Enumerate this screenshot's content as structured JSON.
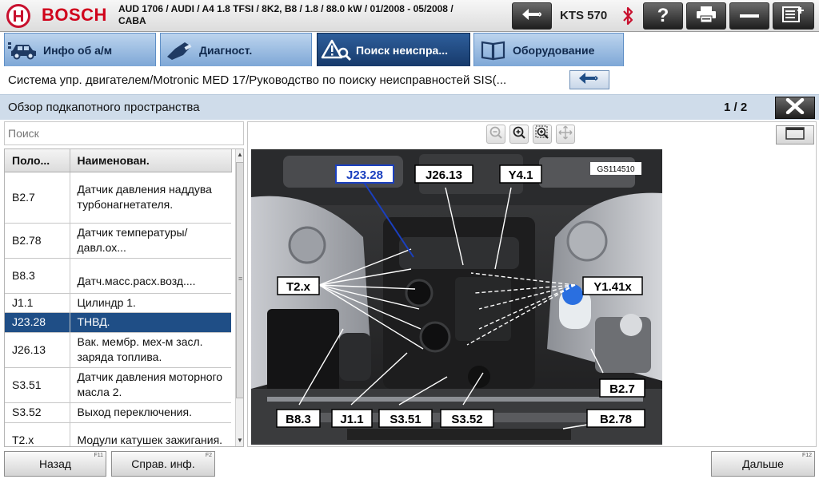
{
  "header": {
    "brand": "BOSCH",
    "vehicle_line1": "AUD 1706 / AUDI / A4 1.8 TFSI / 8K2, B8 / 1.8 / 88.0 kW / 01/2008 - 05/2008 /",
    "vehicle_line2": "CABA",
    "device": "KTS 570",
    "icons": [
      "back-arrow-icon",
      "bluetooth-icon",
      "help-icon",
      "print-icon",
      "minimize-icon",
      "menu-icon"
    ]
  },
  "tabs": [
    {
      "label": "Инфо об а/м",
      "icon": "car-info-icon",
      "active": false
    },
    {
      "label": "Диагност.",
      "icon": "diagnostic-plug-icon",
      "active": false
    },
    {
      "label": "Поиск неиспра...",
      "icon": "warning-search-icon",
      "active": true
    },
    {
      "label": "Оборудование",
      "icon": "book-icon",
      "active": false
    }
  ],
  "breadcrumb": "Система упр. двигателем/Motronic MED 17/Руководство по поиску неисправностей SIS(...",
  "titlebar": {
    "title": "Обзор подкапотного пространства",
    "page": "1 / 2"
  },
  "search": {
    "placeholder": "Поиск"
  },
  "table": {
    "columns": [
      "Поло...",
      "Наименован."
    ],
    "rows": [
      {
        "code": "B2.7",
        "name": "Датчик давления наддува турбонагнетателя."
      },
      {
        "code": "B2.78",
        "name": "Датчик температуры/давл.ох..."
      },
      {
        "code": "B8.3",
        "name": "Датч.масс.расх.возд...."
      },
      {
        "code": "J1.1",
        "name": "Цилиндр 1."
      },
      {
        "code": "J23.28",
        "name": "ТНВД.",
        "selected": true
      },
      {
        "code": "J26.13",
        "name": "Вак. мембр. мех-м засл. заряда топлива."
      },
      {
        "code": "S3.51",
        "name": "Датчик давления моторного масла 2."
      },
      {
        "code": "S3.52",
        "name": "Выход переключения."
      },
      {
        "code": "T2.x",
        "name": "Модули катушек зажигания."
      }
    ]
  },
  "image": {
    "ref": "GS114510",
    "labels": [
      "J23.28",
      "J26.13",
      "Y4.1",
      "T2.x",
      "Y1.41x",
      "B2.7",
      "B8.3",
      "J1.1",
      "S3.51",
      "S3.52",
      "B2.78"
    ],
    "highlight": "J23.28",
    "highlight_color": "#1a3fbf"
  },
  "footer": {
    "back": "Назад",
    "back_key": "F11",
    "info": "Справ. инф.",
    "info_key": "F2",
    "next": "Дальше",
    "next_key": "F12"
  },
  "colors": {
    "brand_red": "#d0021b",
    "tab_active": "#1f4577",
    "row_selected": "#1f4e86",
    "titlebar": "#cfdcea"
  }
}
